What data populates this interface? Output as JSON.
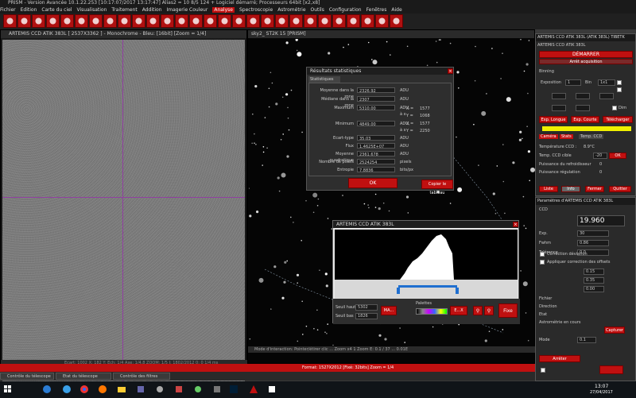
{
  "titlebar": "PRISM - Version Avancée 10.1.22.253  [10:17:07/2017 13:17:47]  Alias2 = 10 8/5 124  + Logiciel démarré; Processeurs 64bit [x2,x8]",
  "menu": [
    "Fichier",
    "Edition",
    "Carte du ciel",
    "Visualisation",
    "Traitement",
    "Addition",
    "Imagerie Couleur",
    "Analyse",
    "Spectroscopie",
    "Astrométrie",
    "Outils",
    "Configuration",
    "Fenêtres",
    "Aide"
  ],
  "menu_active": "Analyse",
  "left_window": {
    "title": "ARTEMIS CCD ATIK 383L [ 2537X3362 ] - Monochrome - Bleu: [16bit] [Zoom = 1/4]",
    "status": "Ecart: 1002   X: 182   Y: Ech: 1/4   Axe: 1/4.8   ZOOM: 1/5   I: 1802/2012   0: 0  1/4 ms"
  },
  "star_window": {
    "title": "sky2_ ST2K 15 [PRISM]",
    "status": "Mode d'interaction: Pointer/étirer clic ... Zoom x4 1 Zoom   E: 0.1 / 37 ... 0.01E"
  },
  "stats_dialog": {
    "title": "Résultats statistiques",
    "tab": "Statistiques",
    "rows": [
      {
        "label": "Moyenne dans la zone",
        "value": "2326.92",
        "unit": "ADU"
      },
      {
        "label": "Médiane dans la zone",
        "value": "2307",
        "unit": "ADU"
      },
      {
        "label": "Maximum",
        "value": "5310.00",
        "unit": "ADU, à x"
      },
      {
        "label": "Minimum",
        "value": "4849.00",
        "unit": "ADU, à x"
      },
      {
        "label": "Ecart-type",
        "value": "35.03",
        "unit": "ADU"
      },
      {
        "label": "Flux",
        "value": "1.4625E+07",
        "unit": "ADU"
      },
      {
        "label": "Moyenne quadratique",
        "value": "2361.678",
        "unit": "ADU"
      },
      {
        "label": "Nombre de pixels",
        "value": "2524254",
        "unit": "pixels"
      },
      {
        "label": "Entropie",
        "value": "7.8836",
        "unit": "bits/px"
      }
    ],
    "max_xy": {
      "x_label": "X =",
      "x": "1577",
      "y_label": "Y =",
      "y": "1068"
    },
    "min_xy": {
      "x_label": "X =",
      "x": "1577",
      "y_label": "Y =",
      "y": "2250"
    },
    "ok_label": "OK",
    "copy_label": "Copier le tableau"
  },
  "histogram": {
    "title": "ARTEMIS CCD ATIK 383L",
    "seuil_haut_label": "Seuil haut",
    "seuil_haut": "5302",
    "seuil_bas_label": "Seuil bas",
    "seuil_bas": "1826",
    "max_button": "MA...",
    "palette_label": "Palettes",
    "ex_button": "E...X",
    "fix_button": "Fixe"
  },
  "right_panel_1": {
    "title": "ARTEMIS CCD ATIK 383L (ATIK 383L) TIBETK",
    "subtitle": "ARTEMIS CCD ATIK 383L",
    "start_button": "DÉMARRER",
    "stop_button": "Arrêt acquisition",
    "capture_label": "Binning",
    "exposure_label": "Exposition",
    "exposure_value": "1",
    "binning_label": "Bin",
    "binning_value": "1x1",
    "cooler_label": "Dim",
    "buttons": [
      "Exp. Longue",
      "Exp. Courte",
      "Télécharger"
    ],
    "tabs": [
      "Caméra",
      "Stats",
      "Temp. CCD"
    ],
    "temp_label": "Température CCD : ",
    "temp_value": "8.9°C",
    "target_label": "Temp. CCD cible",
    "target_value": "-20",
    "fan_label": "Puissance du refroidisseur",
    "fan_value": "0",
    "heat_label": "Puissance régulation",
    "heat_value": "0",
    "bottom_buttons": [
      "Liste",
      "Info",
      "Fermer",
      "Quitter"
    ]
  },
  "right_panel_2": {
    "title": "Paramètres d'ARTEMIS CCD ATIK 383L",
    "ccd_label": "CCD",
    "temp_display": "19.960",
    "rows": [
      {
        "label": "Exp.",
        "value": "30"
      },
      {
        "label": "Fwhm",
        "value": "0.86"
      },
      {
        "label": "Tolérance",
        "value": "0.0"
      }
    ],
    "check1": "Correction déviation",
    "check2": "Appliquer correction des offsets",
    "field_a": "0.15",
    "field_b": "0.35",
    "field_c": "0.00",
    "info_rows": [
      "Fichier",
      "Direction",
      "Etat",
      "Astrométrie en cours"
    ],
    "capture_btn": "Capturer",
    "mode_label": "Mode",
    "mode_value": "0.1",
    "stop_btn": "Arrêter"
  },
  "bottom_tabs": [
    "Contrôle du télescope",
    "Etat du télescope",
    "Contrôle des filtres"
  ],
  "bottom_status": "Format: 1527X2012 [Fixé: 32bits]  Zoom = 1/4",
  "taskbar": {
    "time": "13:07",
    "date": "27/04/2017"
  },
  "colors": {
    "accent": "#c01010",
    "crosshair": "#9040a0",
    "histo_slider": "#1f6fd0"
  }
}
